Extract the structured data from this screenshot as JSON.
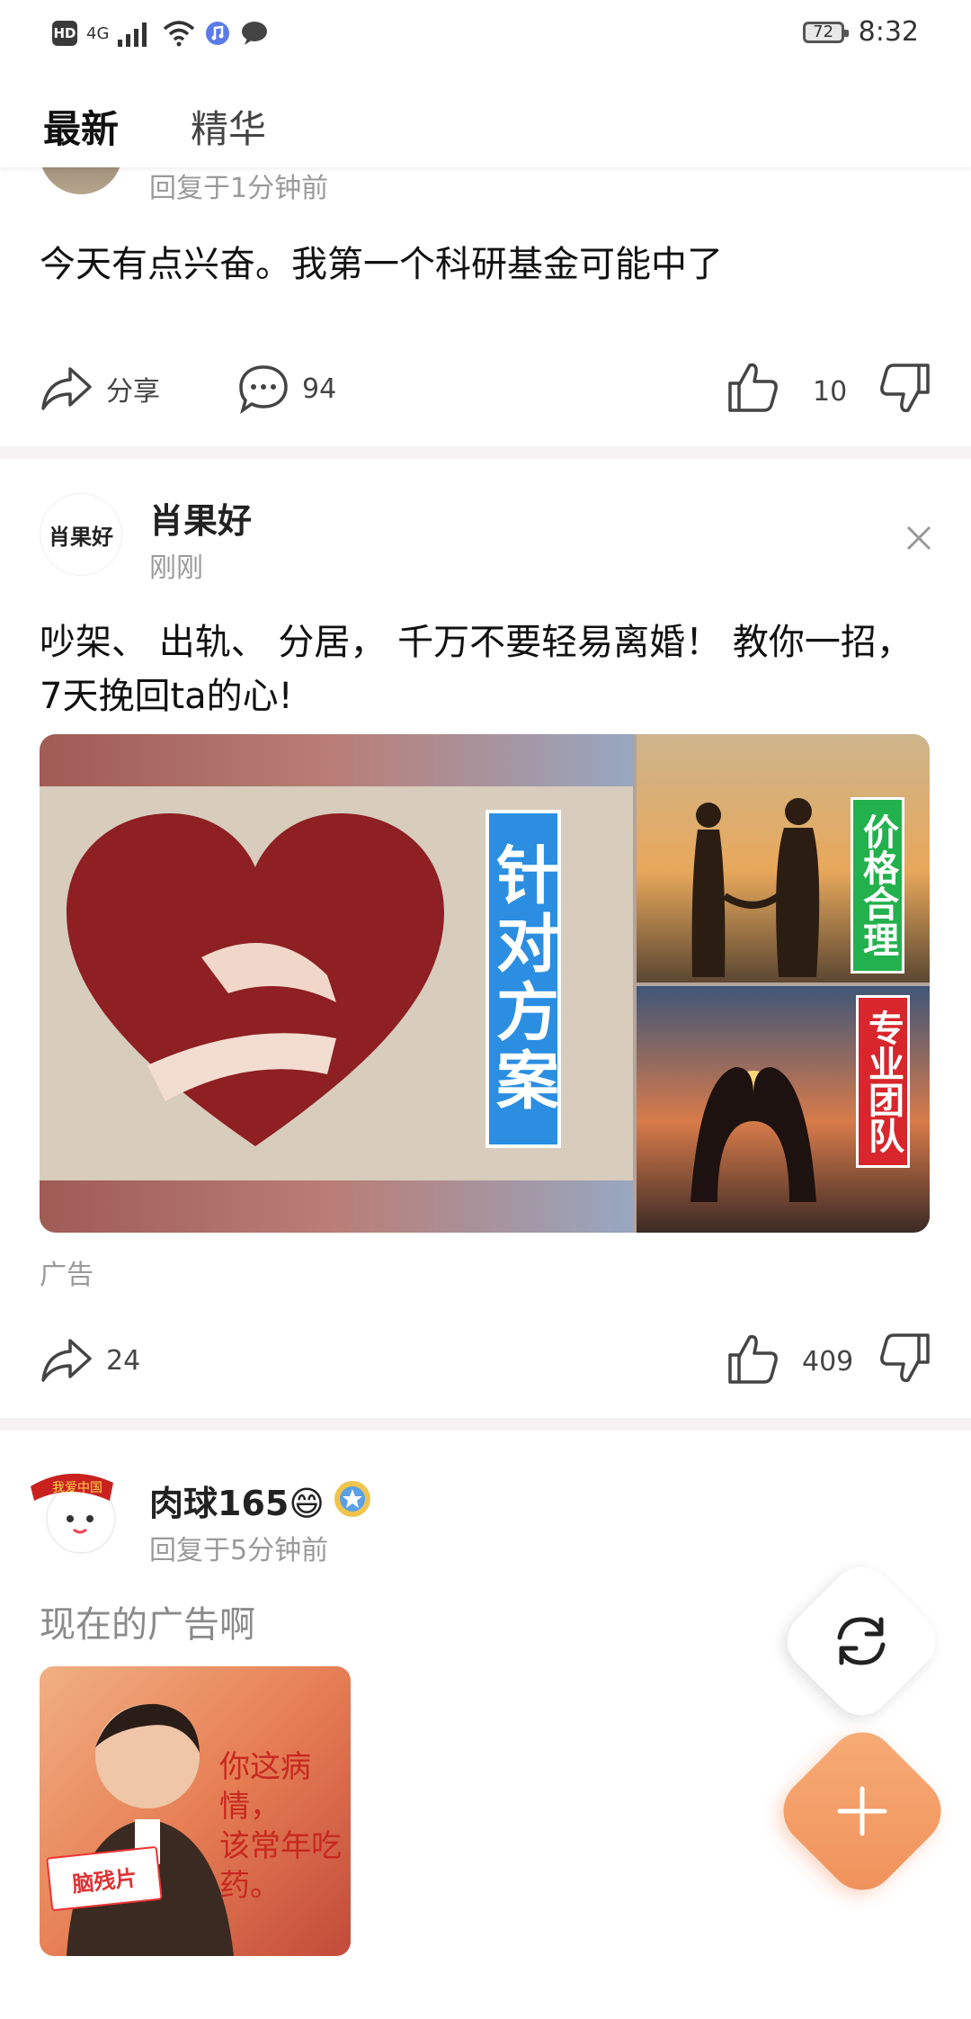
{
  "status_bar": {
    "hd_label": "HD",
    "network_label": "4G",
    "battery_level": "72",
    "time": "8:32"
  },
  "tabs": {
    "active": "最新",
    "inactive": "精华"
  },
  "post1": {
    "meta": "回复于1分钟前",
    "content": "今天有点兴奋。我第一个科研基金可能中了",
    "share_label": "分享",
    "comment_count": "94",
    "like_count": "10"
  },
  "ad_post": {
    "avatar_text": "肖果好",
    "username": "肖果好",
    "meta": "刚刚",
    "content": "吵架、 出轨、 分居， 千万不要轻易离婚！ 教你一招， 7天挽回ta的心!",
    "main_tag": "针对方案",
    "tag_green": "价格合理",
    "tag_red": "专业团队",
    "ad_label": "广告",
    "share_count": "24",
    "like_count": "409"
  },
  "post3": {
    "username": "肉球165😄",
    "meta": "回复于5分钟前",
    "content": "现在的广告啊",
    "photo_text_line1": "你这病情，",
    "photo_text_line2": "该常年吃药。",
    "photo_box_text": "脑残片"
  },
  "colors": {
    "accent_orange": "#f39a63",
    "divider": "#f6f1f3"
  }
}
